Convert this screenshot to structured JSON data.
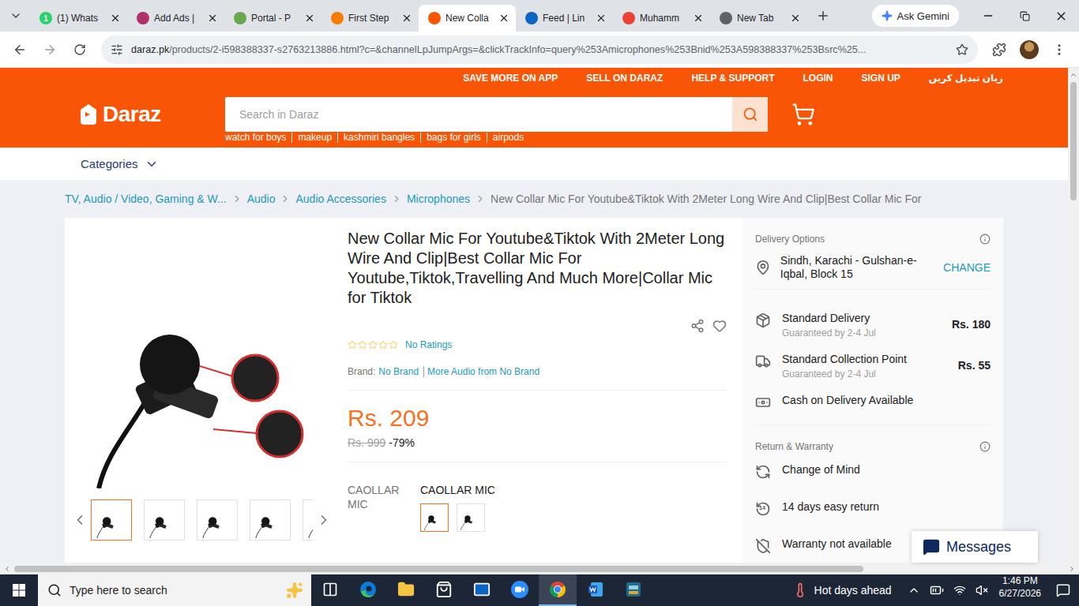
{
  "browser": {
    "tabs": [
      {
        "label": "(1) Whats",
        "selected": false,
        "color": "#25d366",
        "badge": "1"
      },
      {
        "label": "Add Ads |",
        "selected": false,
        "color": "#b0306a"
      },
      {
        "label": "Portal - P",
        "selected": false,
        "color": "#6aa84f"
      },
      {
        "label": "First Step",
        "selected": false,
        "color": "#f57c00"
      },
      {
        "label": "New Colla",
        "selected": true,
        "color": "#f85606"
      },
      {
        "label": "Feed | Lin",
        "selected": false,
        "color": "#0a66c2"
      },
      {
        "label": "Muhamm",
        "selected": false,
        "color": "#ea4335"
      },
      {
        "label": "New Tab",
        "selected": false,
        "color": "#5f6368"
      }
    ],
    "gemini": "Ask Gemini",
    "url_host": "daraz.pk",
    "url_path": "/products/2-i598388337-s2763213886.html?c=&channelLpJumpArgs=&clickTrackInfo=query%253Amicrophones%253Bnid%253A598388337%253Bsrc%25..."
  },
  "header": {
    "logo": "Daraz",
    "top_links": [
      "SAVE MORE ON APP",
      "SELL ON DARAZ",
      "HELP & SUPPORT",
      "LOGIN",
      "SIGN UP",
      "زبان تبدیل کریں"
    ],
    "search": {
      "placeholder": "Search in Daraz"
    },
    "suggestions": [
      "watch for boys",
      "makeup",
      "kashmiri bangles",
      "bags for girls",
      "airpods"
    ]
  },
  "categories": "Categories",
  "breadcrumb": [
    {
      "label": "TV, Audio / Video, Gaming & W...",
      "current": false
    },
    {
      "label": "Audio",
      "current": false
    },
    {
      "label": "Audio Accessories",
      "current": false
    },
    {
      "label": "Microphones",
      "current": false
    },
    {
      "label": "New Collar Mic For Youtube&Tiktok With 2Meter Long Wire And Clip|Best Collar Mic For",
      "current": true
    }
  ],
  "product": {
    "title": "New Collar Mic For Youtube&Tiktok With 2Meter Long Wire And Clip|Best Collar Mic For Youtube,Tiktok,Travelling And Much More|Collar Mic for Tiktok",
    "rating": {
      "stars": 0,
      "text": "No Ratings"
    },
    "brand_label": "Brand:",
    "brand": "No Brand",
    "more_from": "More Audio from No Brand",
    "price": "Rs. 209",
    "original_price": "Rs. 999",
    "discount": "-79%",
    "variation": {
      "label": "CAOLLAR MIC",
      "value": "CAOLLAR MIC",
      "options": [
        {
          "selected": true
        },
        {
          "selected": false
        }
      ]
    },
    "gallery": [
      {
        "selected": true
      },
      {
        "selected": false
      },
      {
        "selected": false
      },
      {
        "selected": false
      },
      {
        "selected": false
      }
    ]
  },
  "delivery": {
    "title": "Delivery Options",
    "location": "Sindh, Karachi - Gulshan-e-Iqbal, Block 15",
    "change": "CHANGE",
    "options": [
      {
        "kind": "delivery",
        "name": "Standard Delivery",
        "note": "Guaranteed by 2-4 Jul",
        "price": "Rs. 180"
      },
      {
        "kind": "collection",
        "name": "Standard Collection Point",
        "note": "Guaranteed by 2-4 Jul",
        "price": "Rs. 55"
      },
      {
        "kind": "cod",
        "name": "Cash on Delivery Available"
      }
    ]
  },
  "warranty": {
    "title": "Return & Warranty",
    "items": [
      {
        "kind": "change",
        "label": "Change of Mind"
      },
      {
        "kind": "return",
        "label": "14 days easy return",
        "badge": "14"
      },
      {
        "kind": "warranty",
        "label": "Warranty not available"
      }
    ]
  },
  "messages": "Messages",
  "taskbar": {
    "search": "Type here to search",
    "apps": [
      {
        "kind": "taskview",
        "selected": false
      },
      {
        "kind": "edge",
        "selected": false
      },
      {
        "kind": "explorer",
        "selected": false
      },
      {
        "kind": "store",
        "selected": false
      },
      {
        "kind": "outlook",
        "selected": false
      },
      {
        "kind": "zoom",
        "selected": false
      },
      {
        "kind": "chrome",
        "selected": true
      },
      {
        "kind": "word",
        "selected": false
      },
      {
        "kind": "calendar",
        "selected": false
      }
    ],
    "weather": "Hot days ahead",
    "time": "1:46 PM",
    "date": "6/27/2026"
  }
}
